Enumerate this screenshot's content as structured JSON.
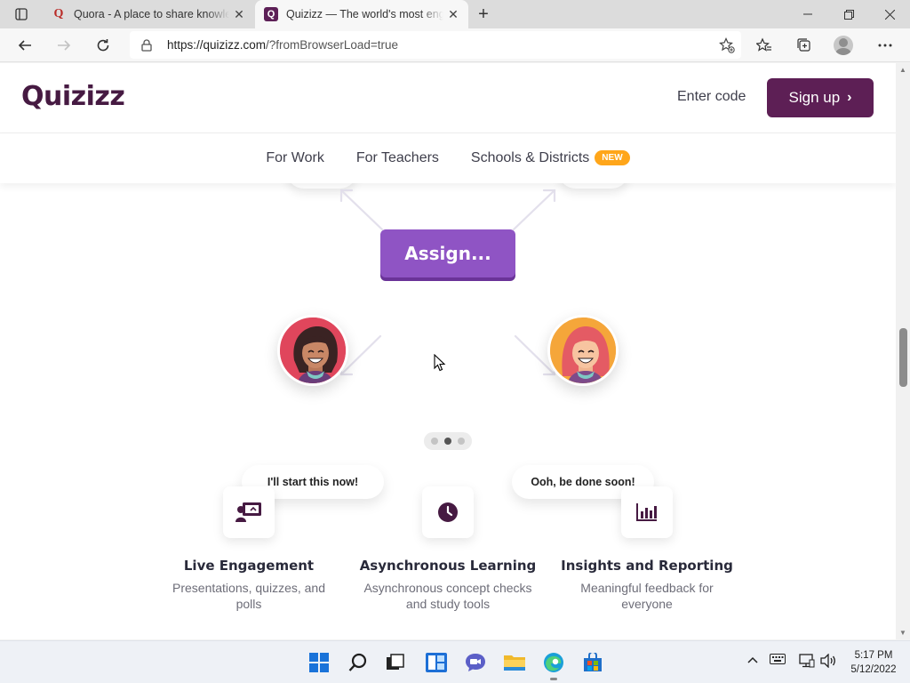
{
  "browser": {
    "tabs": [
      {
        "title": "Quora - A place to share knowledge",
        "favicon": "quora-icon",
        "active": false
      },
      {
        "title": "Quizizz — The world's most engaging",
        "favicon": "quizizz-icon",
        "active": true
      }
    ],
    "new_tab_symbol": "+",
    "url_host": "https://quizizz.com",
    "url_path": "/?fromBrowserLoad=true"
  },
  "site": {
    "logo": "Quizizz",
    "enter_code": "Enter code",
    "signup": "Sign up",
    "nav": [
      {
        "label": "For Work"
      },
      {
        "label": "For Teachers"
      },
      {
        "label": "Schools & Districts",
        "badge": "NEW"
      }
    ],
    "assign_label": "Assign...",
    "speech_left": "I'll start this now!",
    "speech_right": "Ooh, be done soon!",
    "carousel": {
      "count": 3,
      "active": 1
    },
    "features": [
      {
        "title": "Live Engagement",
        "desc": "Presentations, quizzes, and polls",
        "icon": "presentation-icon"
      },
      {
        "title": "Asynchronous Learning",
        "desc": "Asynchronous concept checks and study tools",
        "icon": "clock-icon"
      },
      {
        "title": "Insights and Reporting",
        "desc": "Meaningful feedback for everyone",
        "icon": "bar-chart-icon"
      }
    ]
  },
  "taskbar": {
    "time": "5:17 PM",
    "date": "5/12/2022"
  },
  "colors": {
    "brand_purple": "#5d1f55",
    "assign_purple": "#8f54c4",
    "new_badge": "#ffa61a"
  }
}
